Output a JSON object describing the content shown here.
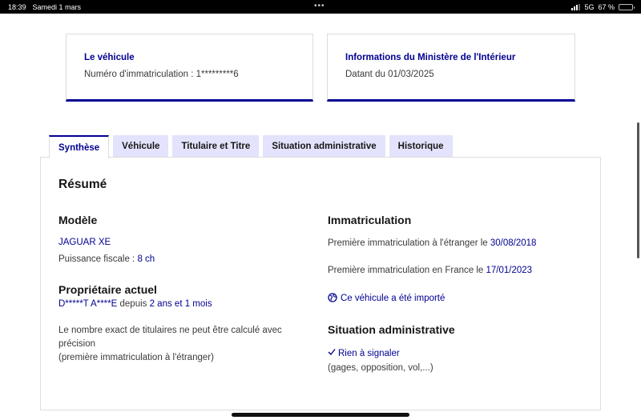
{
  "status_bar": {
    "time": "18:39",
    "date": "Samedi 1 mars",
    "dots": "•••",
    "network": "5G",
    "battery": "67 %",
    "battery_level": 0.67
  },
  "cards": [
    {
      "title": "Le véhicule",
      "text": "Numéro d'immatriculation : 1*********6"
    },
    {
      "title": "Informations du Ministère de l'Intérieur",
      "text": "Datant du 01/03/2025"
    }
  ],
  "tabs": [
    {
      "label": "Synthèse",
      "active": true
    },
    {
      "label": "Véhicule",
      "active": false
    },
    {
      "label": "Titulaire et Titre",
      "active": false
    },
    {
      "label": "Situation administrative",
      "active": false
    },
    {
      "label": "Historique",
      "active": false
    }
  ],
  "summary": {
    "title": "Résumé",
    "model": {
      "heading": "Modèle",
      "name": "JAGUAR XE",
      "power_label": "Puissance fiscale : ",
      "power_value": "8 ch"
    },
    "owner": {
      "heading": "Propriétaire actuel",
      "name": "D*****T A****E",
      "since_label": " depuis ",
      "since_value": "2 ans et 1 mois",
      "note_line1": "Le nombre exact de titulaires ne peut être calculé avec",
      "note_line2": "précision",
      "note_line3": "(première immatriculation à l'étranger)"
    },
    "registration": {
      "heading": "Immatriculation",
      "foreign_label": "Première immatriculation à l'étranger le ",
      "foreign_date": "30/08/2018",
      "france_label": "Première immatriculation en France le ",
      "france_date": "17/01/2023",
      "import_text": "Ce véhicule a été importé",
      "import_icon": "globe-icon"
    },
    "admin": {
      "heading": "Situation administrative",
      "status": "Rien à signaler",
      "status_icon": "check-icon",
      "detail": "(gages, opposition, vol,...)"
    }
  },
  "colors": {
    "accent": "#000091",
    "tab_inactive": "#e3e3fd",
    "border": "#dddddd"
  }
}
